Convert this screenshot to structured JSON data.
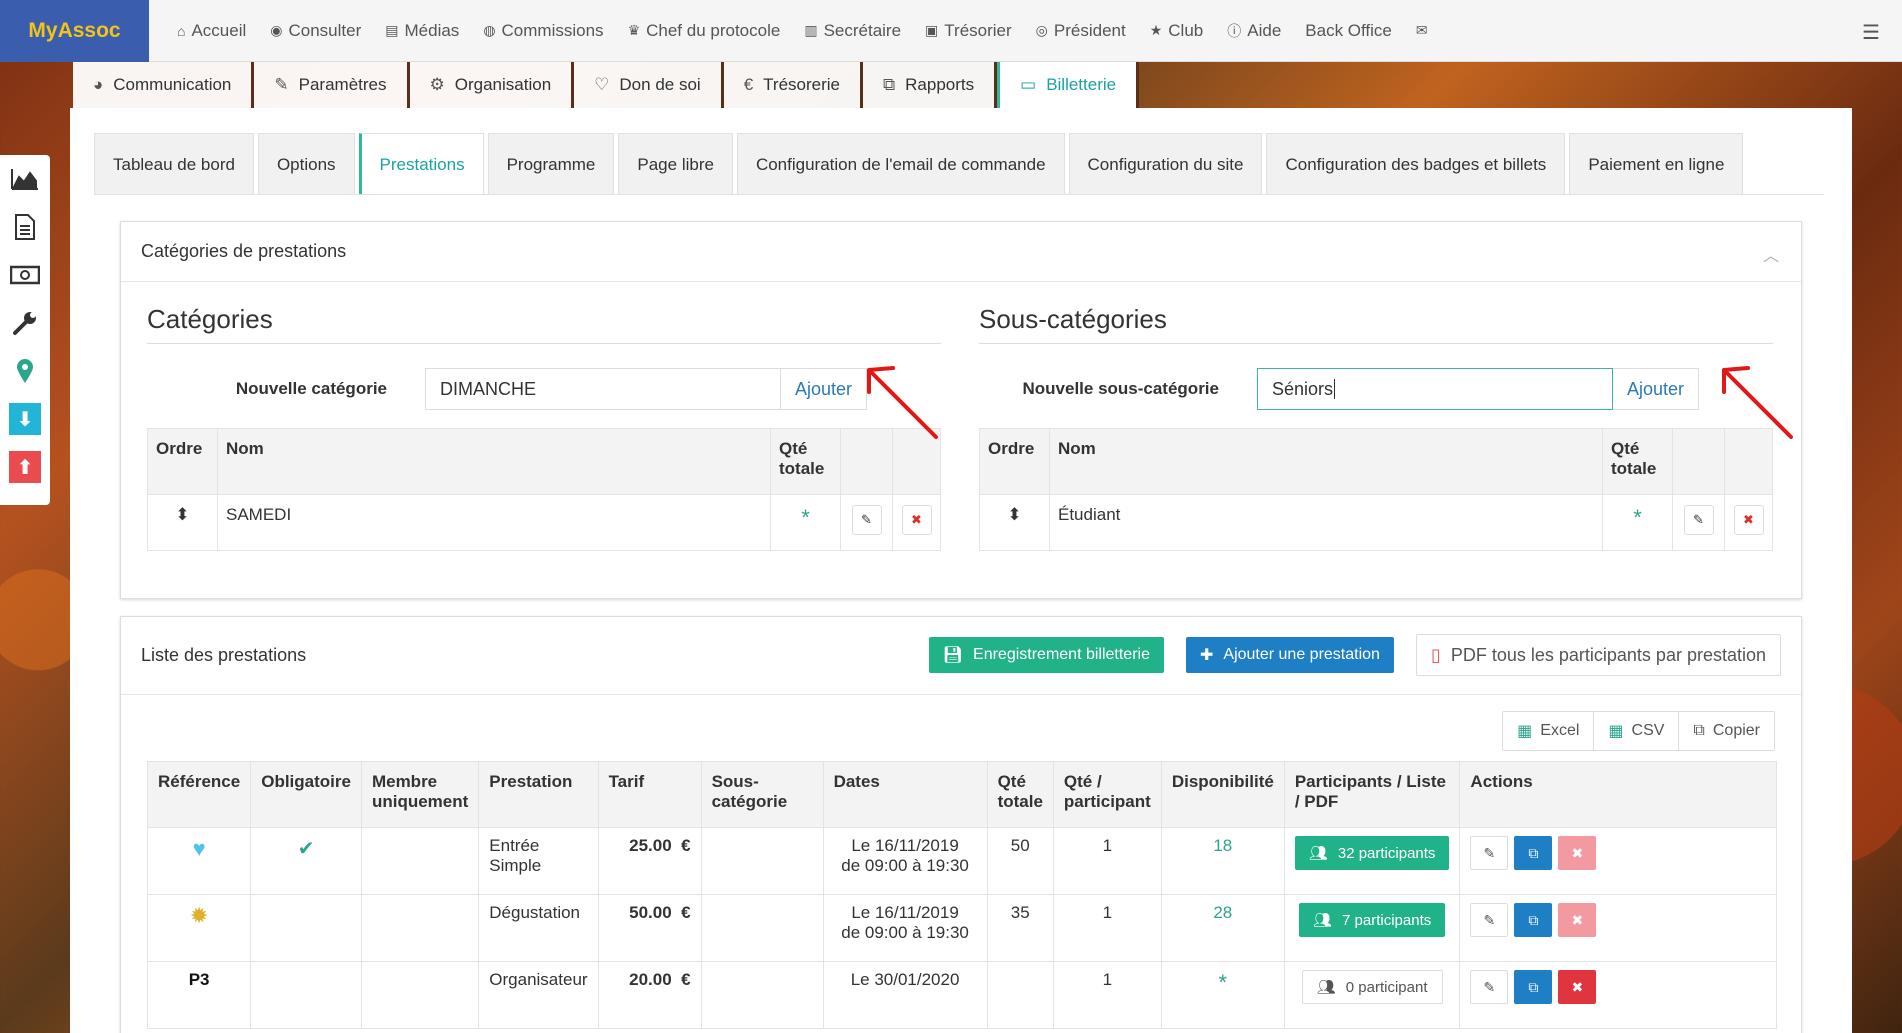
{
  "brand": "MyAssoc",
  "topnav": [
    {
      "icon": "home-icon",
      "glyph": "⌂",
      "label": "Accueil"
    },
    {
      "icon": "eye-icon",
      "glyph": "◉",
      "label": "Consulter"
    },
    {
      "icon": "file-icon",
      "glyph": "▤",
      "label": "Médias"
    },
    {
      "icon": "user-circle-icon",
      "glyph": "◍",
      "label": "Commissions"
    },
    {
      "icon": "trophy-icon",
      "glyph": "♛",
      "label": "Chef du protocole"
    },
    {
      "icon": "book-icon",
      "glyph": "▥",
      "label": "Secrétaire"
    },
    {
      "icon": "money-icon",
      "glyph": "▣",
      "label": "Trésorier"
    },
    {
      "icon": "globe-icon",
      "glyph": "◎",
      "label": "Président"
    },
    {
      "icon": "star-icon",
      "glyph": "★",
      "label": "Club"
    },
    {
      "icon": "info-icon",
      "glyph": "ⓘ",
      "label": "Aide"
    },
    {
      "icon": "",
      "glyph": "",
      "label": "Back Office"
    },
    {
      "icon": "envelope-icon",
      "glyph": "✉",
      "label": ""
    }
  ],
  "modtabs": [
    {
      "icon": "globe-icon",
      "glyph": "◕",
      "label": "Communication"
    },
    {
      "icon": "wrench-icon",
      "glyph": "✎",
      "label": "Paramètres"
    },
    {
      "icon": "cogs-icon",
      "glyph": "⚙",
      "label": "Organisation"
    },
    {
      "icon": "heart-icon",
      "glyph": "♡",
      "label": "Don de soi"
    },
    {
      "icon": "euro-icon",
      "glyph": "€",
      "label": "Trésorerie"
    },
    {
      "icon": "copy-icon",
      "glyph": "⧉",
      "label": "Rapports"
    },
    {
      "icon": "credit-card-icon",
      "glyph": "▭",
      "label": "Billetterie"
    }
  ],
  "subtabs": [
    "Tableau de bord",
    "Options",
    "Prestations",
    "Programme",
    "Page libre",
    "Configuration de l'email de commande",
    "Configuration du site",
    "Configuration des badges et billets",
    "Paiement en ligne"
  ],
  "categories_panel": {
    "title": "Catégories de prestations",
    "left": {
      "heading": "Catégories",
      "label": "Nouvelle catégorie",
      "value": "DIMANCHE",
      "button": "Ajouter",
      "headers": [
        "Ordre",
        "Nom",
        "Qté totale",
        "",
        ""
      ],
      "rows": [
        {
          "name": "SAMEDI"
        }
      ]
    },
    "right": {
      "heading": "Sous-catégories",
      "label": "Nouvelle sous-catégorie",
      "value": "Séniors",
      "button": "Ajouter",
      "headers": [
        "Ordre",
        "Nom",
        "Qté totale",
        "",
        ""
      ],
      "rows": [
        {
          "name": "Étudiant"
        }
      ]
    }
  },
  "prest_panel": {
    "title": "Liste des prestations",
    "btn_save": "Enregistrement billetterie",
    "btn_add": "Ajouter une prestation",
    "btn_pdf": "PDF tous les participants par prestation",
    "export": [
      "Excel",
      "CSV",
      "Copier"
    ],
    "headers": [
      "Référence",
      "Obligatoire",
      "Membre uniquement",
      "Prestation",
      "Tarif",
      "Sous-catégorie",
      "Dates",
      "Qté totale",
      "Qté / participant",
      "Disponibilité",
      "Participants / Liste / PDF",
      "Actions"
    ],
    "rows": [
      {
        "ref": "♥",
        "ref_color": "#4fc3e8",
        "oblig": "✔",
        "membre": "",
        "prest": "Entrée Simple",
        "tarif": "25.00  €",
        "sous": "",
        "date1": "Le 16/11/2019",
        "date2": "de 09:00 à 19:30",
        "qte": "50",
        "qtep": "1",
        "dispo": "18",
        "part": "32 participants",
        "part_style": "green",
        "del_on": false
      },
      {
        "ref": "✹",
        "ref_color": "#e0b028",
        "oblig": "",
        "membre": "",
        "prest": "Dégustation",
        "tarif": "50.00  €",
        "sous": "",
        "date1": "Le 16/11/2019",
        "date2": "de 09:00 à 19:30",
        "qte": "35",
        "qtep": "1",
        "dispo": "28",
        "part": "7 participants",
        "part_style": "green",
        "del_on": false
      },
      {
        "ref": "P3",
        "ref_color": "#111111",
        "oblig": "",
        "membre": "",
        "prest": "Organisateur",
        "tarif": "20.00  €",
        "sous": "",
        "date1": "Le 30/01/2020",
        "date2": "",
        "qte": "",
        "qtep": "1",
        "dispo": "*",
        "part": "0 participant",
        "part_style": "white",
        "del_on": true
      }
    ]
  }
}
